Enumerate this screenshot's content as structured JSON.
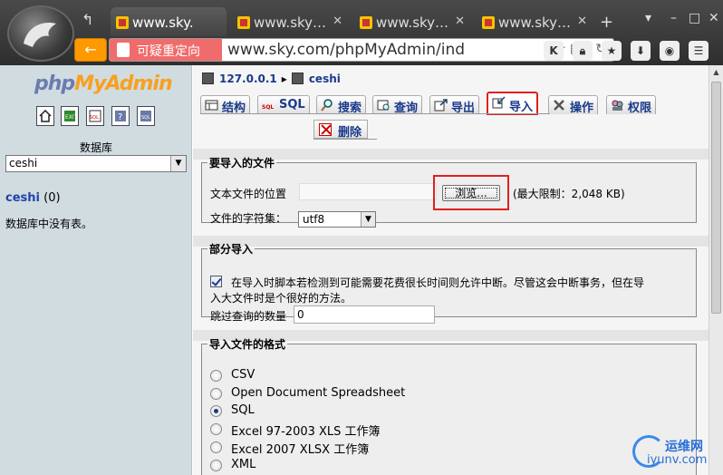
{
  "browser": {
    "tabs": [
      {
        "label": "www.sky."
      },
      {
        "label": "www.sky…"
      },
      {
        "label": "www.sky…"
      },
      {
        "label": "www.sky…"
      }
    ],
    "warning_label": "可疑重定向",
    "url": "www.sky.com/phpMyAdmin/ind"
  },
  "left": {
    "logo_part1": "php",
    "logo_part2": "MyAdmin",
    "database_label": "数据库",
    "database_select_value": "ceshi",
    "current_db_name": "ceshi",
    "current_db_count": " (0)",
    "no_tables_text": "数据库中没有表。"
  },
  "main": {
    "breadcrumb": {
      "server": "127.0.0.1",
      "database": "ceshi"
    },
    "tabs": {
      "structure": "结构",
      "sql": "SQL",
      "search": "搜索",
      "query": "查询",
      "export": "导出",
      "import": "导入",
      "operations": "操作",
      "privileges": "权限",
      "drop": "删除"
    },
    "file_section": {
      "legend": "要导入的文件",
      "location_label": "文本文件的位置",
      "browse_label": "浏览...",
      "max_limit": "(最大限制：2,048 KB)",
      "charset_label": "文件的字符集：",
      "charset_value": "utf8"
    },
    "partial_section": {
      "legend": "部分导入",
      "interrupt_line1": "在导入时脚本若检测到可能需要花费很长时间则允许中断。尽管这会中断事务，但在导",
      "interrupt_line2": "入大文件时是个很好的方法。",
      "interrupt_checked": true,
      "skip_label": "跳过查询的数量",
      "skip_value": "0"
    },
    "format_section": {
      "legend": "导入文件的格式",
      "formats": [
        "CSV",
        "Open Document Spreadsheet",
        "SQL",
        "Excel 97-2003 XLS 工作簿",
        "Excel 2007 XLSX 工作簿",
        "XML"
      ],
      "selected": "SQL"
    }
  },
  "watermark": {
    "cn": "运维网",
    "en": "iyunv.com"
  },
  "colors": {
    "highlight": "#e02020",
    "link": "#1a3a8a",
    "nav_bg": "#d0dce0",
    "warn": "#f06c6c",
    "back_button": "#ff9900"
  }
}
